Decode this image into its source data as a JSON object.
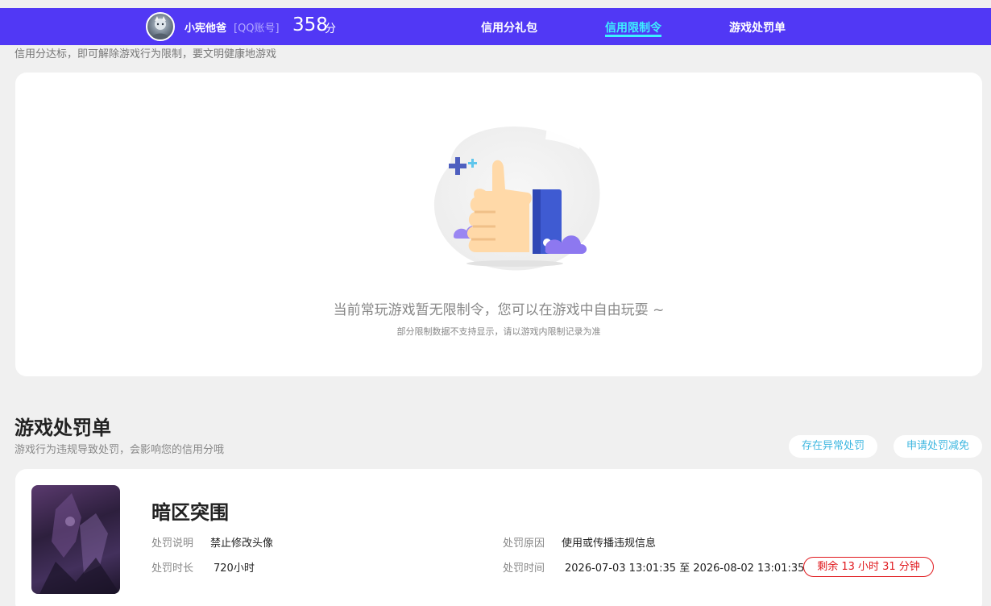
{
  "header": {
    "user_name": "小宪他爸",
    "account_type": "[QQ账号]",
    "score": "358",
    "score_unit": "分",
    "tabs": [
      {
        "label": "信用分礼包",
        "active": false
      },
      {
        "label": "信用限制令",
        "active": true
      },
      {
        "label": "游戏处罚单",
        "active": false
      }
    ],
    "bg_color": "#5138f5",
    "active_color": "#3df1ff"
  },
  "restriction": {
    "note": "信用分达标，即可解除游戏行为限制，要文明健康地游戏",
    "empty_title": "当前常玩游戏暂无限制令，您可以在游戏中自由玩耍 ~",
    "empty_sub": "部分限制数据不支持显示，请以游戏内限制记录为准",
    "illustration_icon": "thumbs-up-icon"
  },
  "penalty": {
    "title": "游戏处罚单",
    "description": "游戏行为违规导致处罚，会影响您的信用分哦",
    "buttons": {
      "abnormal": "存在异常处罚",
      "reduce": "申请处罚减免"
    },
    "item": {
      "game_name": "暗区突围",
      "desc_label": "处罚说明",
      "desc_value": "禁止修改头像",
      "duration_label": "处罚时长",
      "duration_value": "720小时",
      "reason_label": "处罚原因",
      "reason_value": "使用或传播违规信息",
      "time_label": "处罚时间",
      "time_value": "2026-07-03 13:01:35 至 2026-08-02 13:01:35",
      "remaining": "剩余 13 小时 31 分钟"
    }
  }
}
